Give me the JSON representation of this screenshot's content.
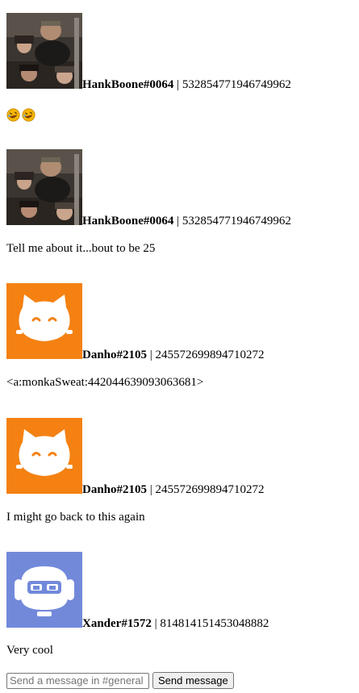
{
  "messages": [
    {
      "avatar": "photo-avatar",
      "username": "HankBoone#0064",
      "separator": "|",
      "user_id": "532854771946749962",
      "text": "",
      "emojis": [
        "rofl-emoji",
        "rofl-emoji"
      ]
    },
    {
      "avatar": "photo-avatar",
      "username": "HankBoone#0064",
      "separator": "|",
      "user_id": "532854771946749962",
      "text": "Tell me about it...bout to be 25"
    },
    {
      "avatar": "orange-cat-avatar",
      "username": "Danho#2105",
      "separator": "|",
      "user_id": "245572699894710272",
      "text": "<a:monkaSweat:442044639093063681>"
    },
    {
      "avatar": "orange-cat-avatar",
      "username": "Danho#2105",
      "separator": "|",
      "user_id": "245572699894710272",
      "text": "I might go back to this again"
    },
    {
      "avatar": "blurple-robot-avatar",
      "username": "Xander#1572",
      "separator": "|",
      "user_id": "814814151453048882",
      "text": "Very cool"
    }
  ],
  "composer": {
    "placeholder": "Send a message in #general",
    "send_label": "Send message"
  },
  "colors": {
    "orange_avatar": "#f48112",
    "blurple_avatar": "#7289da"
  }
}
